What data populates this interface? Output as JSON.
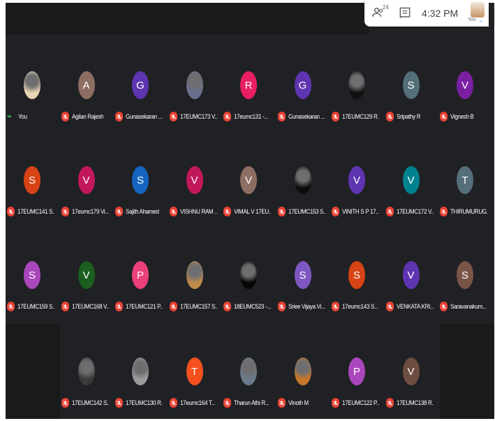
{
  "topbar": {
    "people_count": "24",
    "time": "4:32 PM",
    "self_label": "You",
    "self_dots": "..."
  },
  "colors": {
    "background": "#202124",
    "mic_off": "#ea4335",
    "speaking": "#34a853"
  },
  "rows": [
    [
      {
        "name": "You",
        "initial": "",
        "color": "#e8d5b5",
        "photo": true,
        "muted": false
      },
      {
        "name": "Agilan Rajesh",
        "initial": "A",
        "color": "#8d6e63",
        "photo": false,
        "muted": true
      },
      {
        "name": "Gunasekaran ...",
        "initial": "G",
        "color": "#5e35b1",
        "photo": false,
        "muted": true
      },
      {
        "name": "17EUMC173 V...",
        "initial": "",
        "color": "#6b6f8f",
        "photo": true,
        "muted": true
      },
      {
        "name": "17eumc131 -...",
        "initial": "R",
        "color": "#e91e63",
        "photo": false,
        "muted": true
      },
      {
        "name": "Gunasekaran ...",
        "initial": "G",
        "color": "#5e35b1",
        "photo": false,
        "muted": true
      },
      {
        "name": "17EUMC129 R...",
        "initial": "",
        "color": "#111111",
        "photo": true,
        "muted": true
      },
      {
        "name": "Sripathy R",
        "initial": "S",
        "color": "#546e7a",
        "photo": false,
        "muted": true
      },
      {
        "name": "Vignesh B",
        "initial": "V",
        "color": "#7b1fa2",
        "photo": false,
        "muted": true
      }
    ],
    [
      {
        "name": "17EUMC141 S...",
        "initial": "S",
        "color": "#d84315",
        "photo": false,
        "muted": true
      },
      {
        "name": "17eumc179 Vi...",
        "initial": "V",
        "color": "#c2185b",
        "photo": false,
        "muted": true
      },
      {
        "name": "Sajith Ahamed",
        "initial": "S",
        "color": "#1565c0",
        "photo": false,
        "muted": true
      },
      {
        "name": "VISHNU RAM ...",
        "initial": "V",
        "color": "#c2185b",
        "photo": false,
        "muted": true
      },
      {
        "name": "VIMAL V 17EU...",
        "initial": "V",
        "color": "#8d6e63",
        "photo": false,
        "muted": true
      },
      {
        "name": "17EUMC153 S...",
        "initial": "",
        "color": "#0d0d0d",
        "photo": true,
        "muted": true
      },
      {
        "name": "VINITH S P 17...",
        "initial": "V",
        "color": "#5e35b1",
        "photo": false,
        "muted": true
      },
      {
        "name": "17EUMC172 V...",
        "initial": "V",
        "color": "#00838f",
        "photo": false,
        "muted": true
      },
      {
        "name": "THIRUMURUG...",
        "initial": "T",
        "color": "#546e7a",
        "photo": false,
        "muted": true
      }
    ],
    [
      {
        "name": "17EUMC159 S...",
        "initial": "S",
        "color": "#ab47bc",
        "photo": false,
        "muted": true
      },
      {
        "name": "17EUMC168 V...",
        "initial": "V",
        "color": "#1b5e20",
        "photo": false,
        "muted": true
      },
      {
        "name": "17EUMC121 P...",
        "initial": "P",
        "color": "#ec407a",
        "photo": false,
        "muted": true
      },
      {
        "name": "17EUMC157 S...",
        "initial": "",
        "color": "#c08a4a",
        "photo": true,
        "muted": true
      },
      {
        "name": "18EUMC523 -...",
        "initial": "",
        "color": "#050505",
        "photo": true,
        "muted": true
      },
      {
        "name": "Sriee Vijaya Vi...",
        "initial": "S",
        "color": "#7e57c2",
        "photo": false,
        "muted": true
      },
      {
        "name": "17eumc143 S...",
        "initial": "S",
        "color": "#d84315",
        "photo": false,
        "muted": true
      },
      {
        "name": "VENKATA KRI...",
        "initial": "V",
        "color": "#5e35b1",
        "photo": false,
        "muted": true
      },
      {
        "name": "Saravanakum...",
        "initial": "S",
        "color": "#795548",
        "photo": false,
        "muted": true
      }
    ],
    [
      {
        "name": "17EUMC142 S...",
        "initial": "",
        "color": "#3a3a3a",
        "photo": true,
        "muted": true
      },
      {
        "name": "17EUMC130 R...",
        "initial": "",
        "color": "#9a9a9a",
        "photo": true,
        "muted": true
      },
      {
        "name": "17eumc164 T...",
        "initial": "T",
        "color": "#f4511e",
        "photo": false,
        "muted": true
      },
      {
        "name": "Tharun Athi R...",
        "initial": "",
        "color": "#6b7b8c",
        "photo": true,
        "muted": true
      },
      {
        "name": "Vinoth M",
        "initial": "",
        "color": "#c7782a",
        "photo": true,
        "muted": true
      },
      {
        "name": "17EUMC122 P...",
        "initial": "P",
        "color": "#ab47bc",
        "photo": false,
        "muted": true
      },
      {
        "name": "17EUMC138 R...",
        "initial": "V",
        "color": "#6d4c41",
        "photo": false,
        "muted": true
      }
    ]
  ]
}
